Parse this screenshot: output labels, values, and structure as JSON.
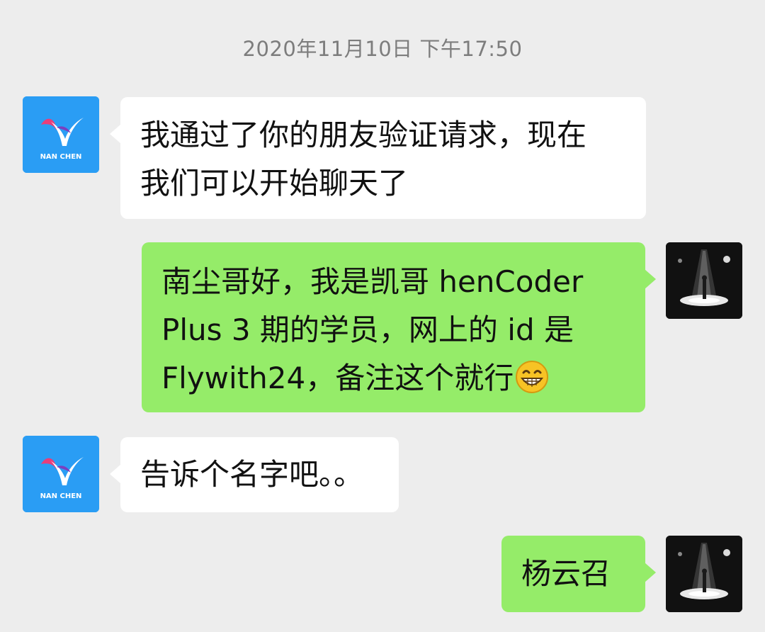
{
  "conversation": {
    "timestamp": "2020年11月10日 下午17:50",
    "contact_avatar_text": "NAN CHEN",
    "messages": [
      {
        "sender": "contact",
        "lines": [
          "我通过了你的朋友验证请求，现在",
          "我们可以开始聊天了"
        ]
      },
      {
        "sender": "me",
        "lines": [
          "南尘哥好，我是凯哥 henCoder",
          "Plus 3 期的学员，网上的 id 是",
          "Flywith24，备注这个就行"
        ],
        "emoji": "grinning-face-emoji"
      },
      {
        "sender": "contact",
        "lines": [
          "告诉个名字吧。。"
        ]
      },
      {
        "sender": "me",
        "lines": [
          "杨云召"
        ]
      }
    ]
  },
  "colors": {
    "background": "#ededed",
    "incoming_bubble": "#ffffff",
    "outgoing_bubble": "#95ec69",
    "timestamp_text": "#7d7d7d",
    "contact_avatar": "#2a9df4"
  }
}
